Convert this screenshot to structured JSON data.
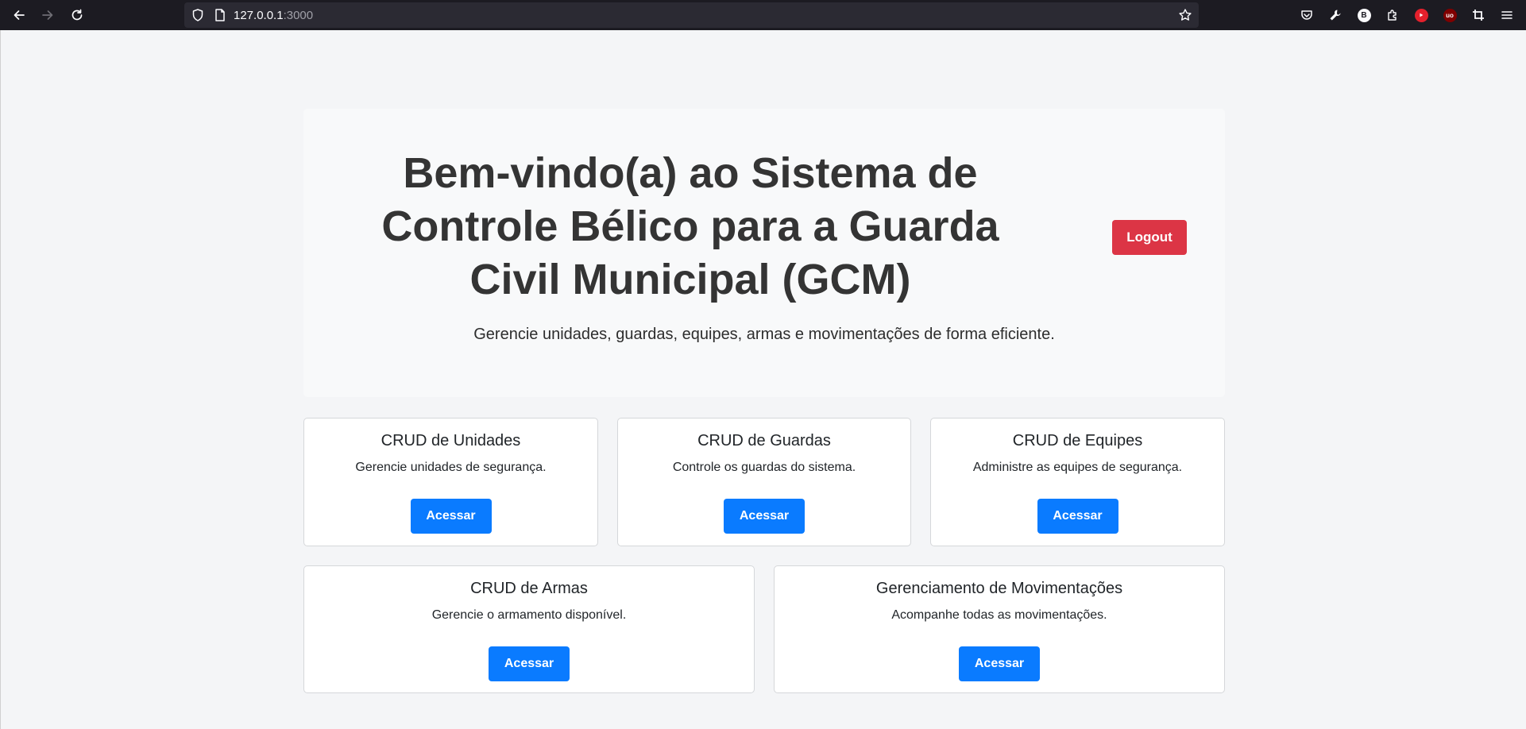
{
  "browser": {
    "url_host": "127.0.0.1",
    "url_port": ":3000",
    "toolbar_icons": [
      "pocket-icon",
      "wrench-icon",
      "bitwarden-icon",
      "extension-icon",
      "youtube-icon",
      "ublock-icon",
      "crop-icon",
      "menu-icon"
    ]
  },
  "hero": {
    "title": "Bem-vindo(a) ao Sistema de Controle Bélico para a Guarda Civil Municipal (GCM)",
    "subtitle": "Gerencie unidades, guardas, equipes, armas e movimentações de forma eficiente.",
    "logout_label": "Logout"
  },
  "cards": [
    {
      "title": "CRUD de Unidades",
      "text": "Gerencie unidades de segurança.",
      "button": "Acessar"
    },
    {
      "title": "CRUD de Guardas",
      "text": "Controle os guardas do sistema.",
      "button": "Acessar"
    },
    {
      "title": "CRUD de Equipes",
      "text": "Administre as equipes de segurança.",
      "button": "Acessar"
    },
    {
      "title": "CRUD de Armas",
      "text": "Gerencie o armamento disponível.",
      "button": "Acessar"
    },
    {
      "title": "Gerenciamento de Movimentações",
      "text": "Acompanhe todas as movimentações.",
      "button": "Acessar"
    }
  ],
  "colors": {
    "primary": "#0a7bff",
    "danger": "#dc3545",
    "page_bg": "#f4f5f7",
    "jumbotron_bg": "#f8f9fa",
    "chrome_bg": "#1c1b22"
  }
}
